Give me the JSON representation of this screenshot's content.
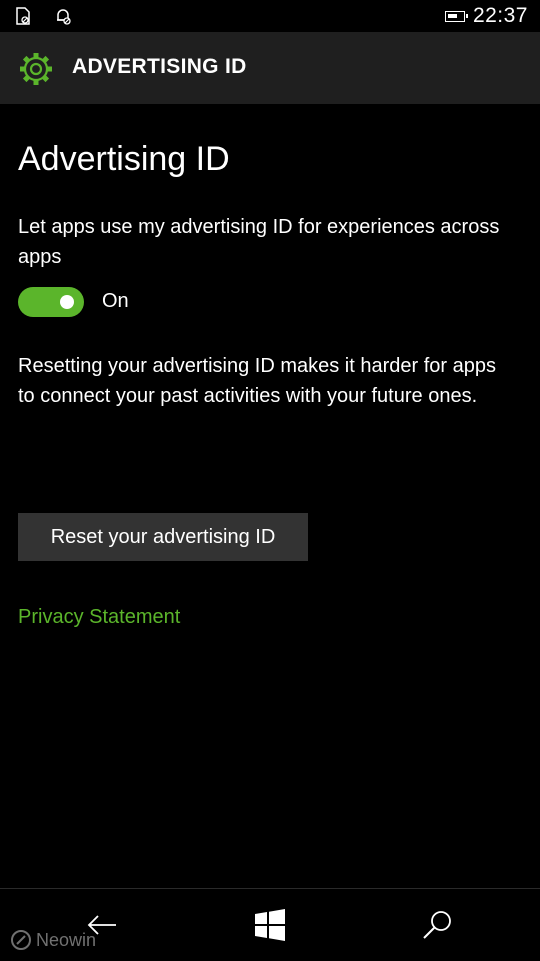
{
  "colors": {
    "accent": "#5bb52b",
    "header_bg": "#1f1f1f",
    "button_bg": "#333333"
  },
  "status_bar": {
    "time": "22:37",
    "icons": [
      "sim-icon",
      "notification-icon",
      "battery-icon"
    ],
    "battery_level": 0.7
  },
  "header": {
    "icon": "gear-icon",
    "title": "ADVERTISING ID"
  },
  "main": {
    "heading": "Advertising ID",
    "toggle_description": "Let apps use my advertising ID for experiences across apps",
    "toggle": {
      "state": true,
      "label": "On"
    },
    "reset_description": "Resetting your advertising ID makes it harder for apps to connect your past activities with your future ones.",
    "reset_button_label": "Reset your advertising ID",
    "privacy_link_label": "Privacy Statement"
  },
  "nav_bar": {
    "icons": [
      "back-arrow-icon",
      "windows-logo-icon",
      "search-icon"
    ],
    "watermark": "Neowin"
  }
}
